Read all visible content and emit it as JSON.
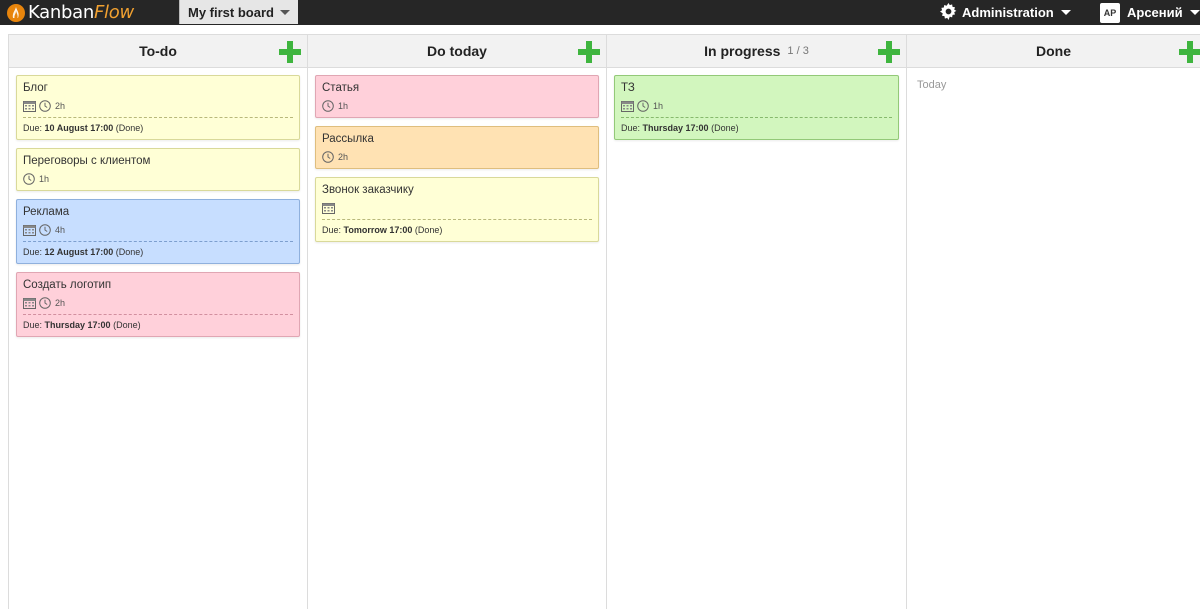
{
  "app": {
    "logo_prefix": "Kanban",
    "logo_suffix": "Flow"
  },
  "board": {
    "name": "My first board"
  },
  "admin": {
    "label": "Administration"
  },
  "user": {
    "initials": "AP",
    "name": "Арсений"
  },
  "colors": {
    "add": "#3fb53f",
    "topbar": "#262626"
  },
  "columns": [
    {
      "title": "To-do",
      "count": "",
      "cards": [
        {
          "title": "Блог",
          "color": "yellow",
          "time": "2h",
          "due_prefix": "Due:",
          "due_date": "10 August 17:00",
          "due_status": "(Done)"
        },
        {
          "title": "Переговоры с клиентом",
          "color": "yellow",
          "time": "1h"
        },
        {
          "title": "Реклама",
          "color": "blue",
          "time": "4h",
          "due_prefix": "Due:",
          "due_date": "12 August 17:00",
          "due_status": "(Done)"
        },
        {
          "title": "Создать логотип",
          "color": "pink",
          "time": "2h",
          "due_prefix": "Due:",
          "due_date": "Thursday 17:00",
          "due_status": "(Done)"
        }
      ]
    },
    {
      "title": "Do today",
      "count": "",
      "cards": [
        {
          "title": "Статья",
          "color": "pink",
          "time": "1h"
        },
        {
          "title": "Рассылка",
          "color": "orange",
          "time": "2h"
        },
        {
          "title": "Звонок заказчику",
          "color": "yellow",
          "time": "",
          "due_prefix": "Due:",
          "due_date": "Tomorrow 17:00",
          "due_status": "(Done)"
        }
      ]
    },
    {
      "title": "In progress",
      "count": "1 / 3",
      "cards": [
        {
          "title": "ТЗ",
          "color": "green",
          "time": "1h",
          "due_prefix": "Due:",
          "due_date": "Thursday 17:00",
          "due_status": "(Done)"
        }
      ]
    },
    {
      "title": "Done",
      "count": "",
      "section_label": "Today",
      "cards": []
    }
  ]
}
